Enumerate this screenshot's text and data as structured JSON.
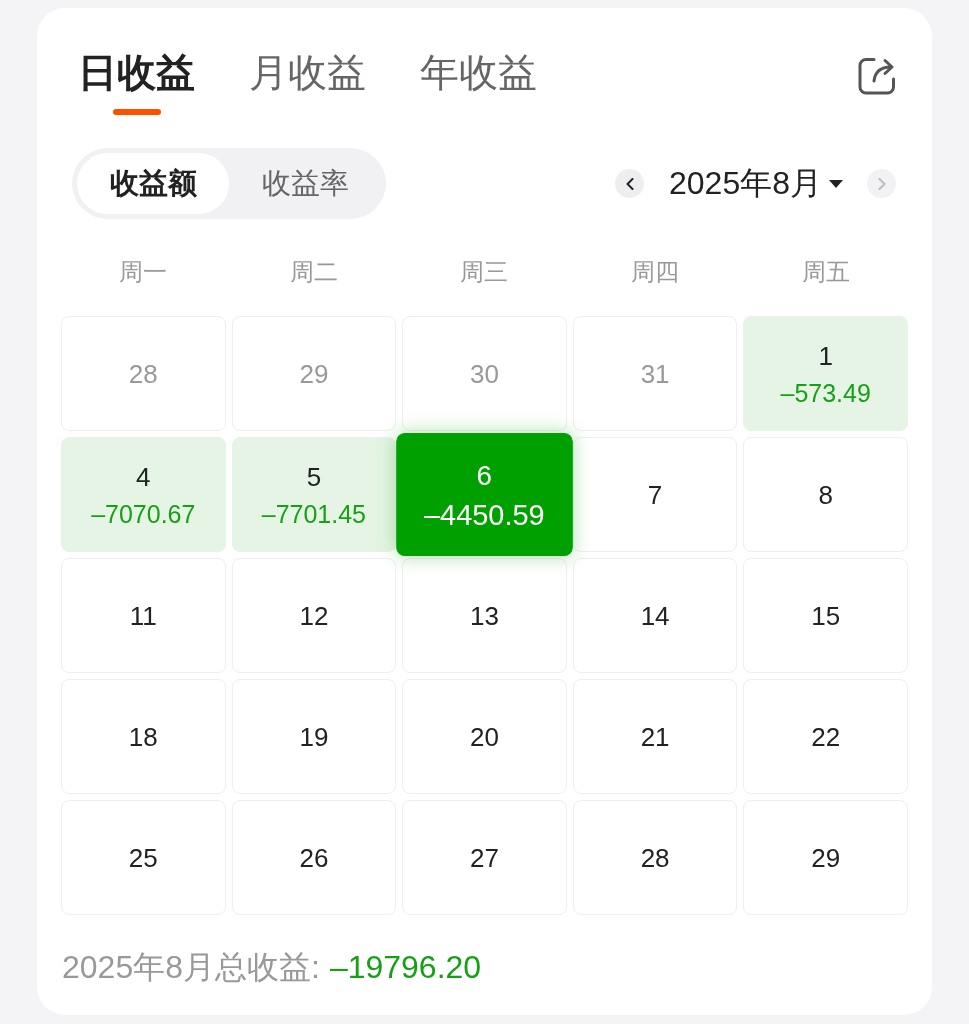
{
  "tabs": [
    {
      "label": "日收益",
      "selected": true
    },
    {
      "label": "月收益",
      "selected": false
    },
    {
      "label": "年收益",
      "selected": false
    }
  ],
  "segments": [
    {
      "label": "收益额",
      "selected": true
    },
    {
      "label": "收益率",
      "selected": false
    }
  ],
  "month_nav": {
    "label": "2025年8月",
    "prev": {
      "disabled": false
    },
    "next": {
      "disabled": true
    }
  },
  "weekdays": [
    "周一",
    "周二",
    "周三",
    "周四",
    "周五"
  ],
  "days": [
    {
      "day": "28",
      "in_month": false,
      "selected": false
    },
    {
      "day": "29",
      "in_month": false,
      "selected": false
    },
    {
      "day": "30",
      "in_month": false,
      "selected": false
    },
    {
      "day": "31",
      "in_month": false,
      "selected": false
    },
    {
      "day": "1",
      "in_month": true,
      "selected": false,
      "value": "–573.49"
    },
    {
      "day": "4",
      "in_month": true,
      "selected": false,
      "value": "–7070.67"
    },
    {
      "day": "5",
      "in_month": true,
      "selected": false,
      "value": "–7701.45"
    },
    {
      "day": "6",
      "in_month": true,
      "selected": true,
      "value": "–4450.59"
    },
    {
      "day": "7",
      "in_month": true,
      "selected": false
    },
    {
      "day": "8",
      "in_month": true,
      "selected": false
    },
    {
      "day": "11",
      "in_month": true,
      "selected": false
    },
    {
      "day": "12",
      "in_month": true,
      "selected": false
    },
    {
      "day": "13",
      "in_month": true,
      "selected": false
    },
    {
      "day": "14",
      "in_month": true,
      "selected": false
    },
    {
      "day": "15",
      "in_month": true,
      "selected": false
    },
    {
      "day": "18",
      "in_month": true,
      "selected": false
    },
    {
      "day": "19",
      "in_month": true,
      "selected": false
    },
    {
      "day": "20",
      "in_month": true,
      "selected": false
    },
    {
      "day": "21",
      "in_month": true,
      "selected": false
    },
    {
      "day": "22",
      "in_month": true,
      "selected": false
    },
    {
      "day": "25",
      "in_month": true,
      "selected": false
    },
    {
      "day": "26",
      "in_month": true,
      "selected": false
    },
    {
      "day": "27",
      "in_month": true,
      "selected": false
    },
    {
      "day": "28",
      "in_month": true,
      "selected": false
    },
    {
      "day": "29",
      "in_month": true,
      "selected": false
    }
  ],
  "total": {
    "label": "2025年8月总收益:",
    "value": "–19796.20"
  }
}
